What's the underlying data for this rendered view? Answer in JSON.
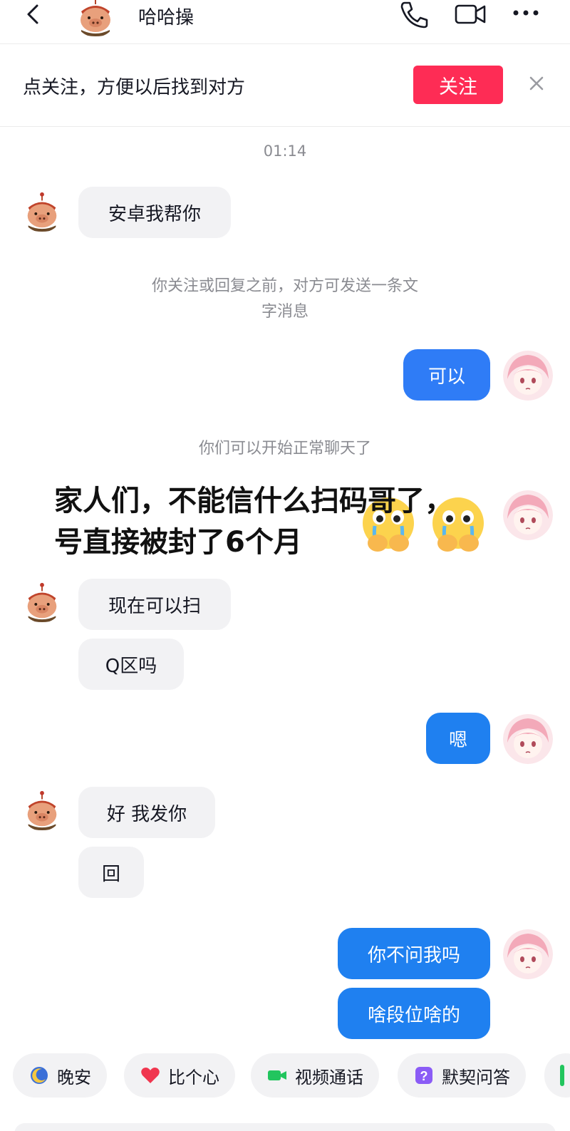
{
  "header": {
    "title": "哈哈操"
  },
  "follow_bar": {
    "text": "点关注，方便以后找到对方",
    "button_label": "关注"
  },
  "chat": {
    "timestamp": "01:14",
    "system_notice_1": "你关注或回复之前，对方可发送一条文字消息",
    "system_notice_1_line1": "你关注或回复之前，对方可发送一条文",
    "system_notice_1_line2": "字消息",
    "system_notice_2": "你们可以开始正常聊天了",
    "messages": [
      {
        "side": "in",
        "text": "安卓我帮你"
      },
      {
        "side": "out",
        "text": "可以"
      },
      {
        "side": "in",
        "text": "现在可以扫"
      },
      {
        "side": "in",
        "text": "Q区吗"
      },
      {
        "side": "out",
        "text": "嗯"
      },
      {
        "side": "in",
        "text": "好 我发你"
      },
      {
        "side": "in",
        "text": "回"
      },
      {
        "side": "out",
        "text": "你不问我吗"
      },
      {
        "side": "out",
        "text": "啥段位啥的"
      }
    ]
  },
  "overlay_caption": {
    "line1": "家人们，不能信什么扫码哥了，",
    "line2": "号直接被封了6个月"
  },
  "quick_replies": [
    {
      "icon": "moon-icon",
      "label": "晚安"
    },
    {
      "icon": "heart-icon",
      "label": "比个心"
    },
    {
      "icon": "video-camera-icon",
      "label": "视频通话"
    },
    {
      "icon": "question-icon",
      "label": "默契问答"
    }
  ],
  "colors": {
    "follow_button": "#fe2c55",
    "outgoing_bubble": "#2f7cf6",
    "incoming_bubble": "#f2f2f4"
  }
}
